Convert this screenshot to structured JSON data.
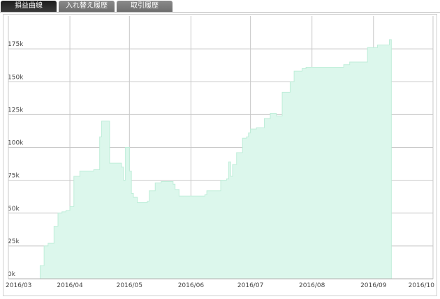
{
  "tabs": [
    {
      "label": "損益曲線",
      "active": true
    },
    {
      "label": "入れ替え履歴",
      "active": false
    },
    {
      "label": "取引履歴",
      "active": false
    }
  ],
  "colors": {
    "fill": "#dcf7ec",
    "line": "#bfeed9",
    "grid": "#c8c8c8"
  },
  "chart_data": {
    "type": "area",
    "title": "",
    "xlabel": "",
    "ylabel": "",
    "x_ticks": [
      "2016/03",
      "2016/04",
      "2016/05",
      "2016/06",
      "2016/07",
      "2016/08",
      "2016/09",
      "2016/10"
    ],
    "y_ticks": [
      "0k",
      "25k",
      "50k",
      "75k",
      "100k",
      "125k",
      "150k",
      "175k"
    ],
    "xlim": [
      "2016-03-01",
      "2016-10-01"
    ],
    "ylim": [
      0,
      200000
    ],
    "grid": true,
    "series": [
      {
        "x": [
          "2016-03-15",
          "2016-03-17",
          "2016-03-19",
          "2016-03-21",
          "2016-03-24",
          "2016-03-26",
          "2016-03-28",
          "2016-03-30",
          "2016-04-01",
          "2016-04-03",
          "2016-04-06",
          "2016-04-13",
          "2016-04-16",
          "2016-04-17",
          "2016-04-20",
          "2016-04-21",
          "2016-04-26",
          "2016-04-27",
          "2016-04-28",
          "2016-04-29",
          "2016-05-01",
          "2016-05-02",
          "2016-05-03",
          "2016-05-05",
          "2016-05-10",
          "2016-05-11",
          "2016-05-14",
          "2016-05-17",
          "2016-05-23",
          "2016-05-24",
          "2016-05-26",
          "2016-06-01",
          "2016-06-08",
          "2016-06-09",
          "2016-06-16",
          "2016-06-17",
          "2016-06-19",
          "2016-06-20",
          "2016-06-21",
          "2016-06-22",
          "2016-06-24",
          "2016-06-27",
          "2016-06-29",
          "2016-06-30",
          "2016-07-01",
          "2016-07-04",
          "2016-07-08",
          "2016-07-11",
          "2016-07-14",
          "2016-07-17",
          "2016-07-21",
          "2016-07-23",
          "2016-07-27",
          "2016-07-29",
          "2016-07-30",
          "2016-08-01",
          "2016-08-09",
          "2016-08-17",
          "2016-08-20",
          "2016-08-29",
          "2016-09-03",
          "2016-09-09",
          "2016-09-10"
        ],
        "y": [
          0,
          10000,
          25000,
          27000,
          40000,
          50000,
          51000,
          52000,
          55000,
          78000,
          82000,
          83000,
          108000,
          120000,
          120000,
          88000,
          88000,
          85000,
          75000,
          100000,
          82000,
          65000,
          62000,
          58000,
          59000,
          67000,
          73000,
          74000,
          72000,
          68000,
          63000,
          63000,
          64000,
          67000,
          75000,
          75000,
          76000,
          89000,
          78000,
          87000,
          96000,
          107000,
          108000,
          111000,
          114000,
          115000,
          122000,
          126000,
          124000,
          142000,
          150000,
          158000,
          160000,
          161000,
          161000,
          161000,
          161000,
          163000,
          165000,
          176000,
          178000,
          182000,
          182000
        ]
      }
    ]
  }
}
